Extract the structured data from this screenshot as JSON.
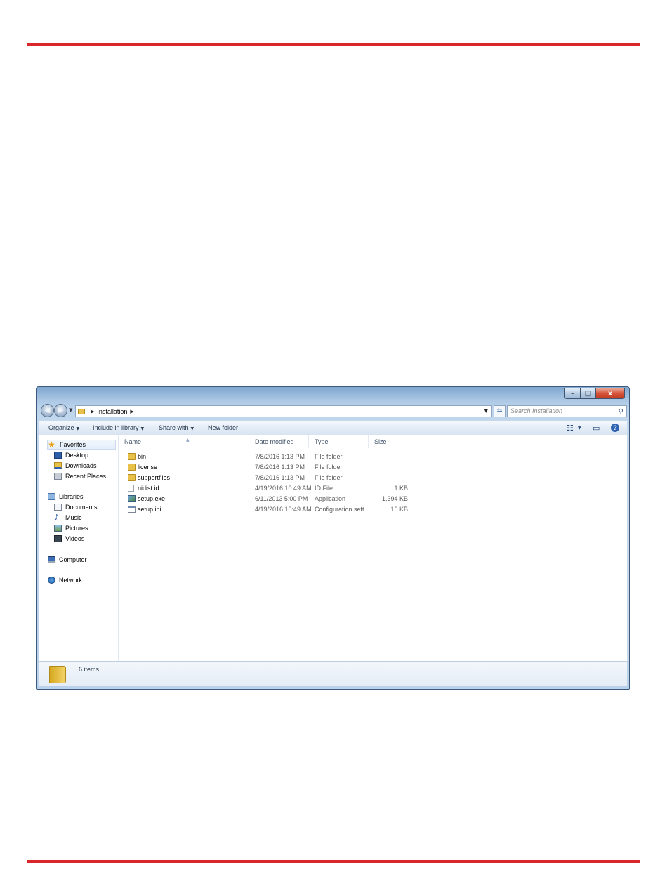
{
  "window": {
    "caption_buttons": {
      "minimize": "–",
      "maximize": "□",
      "close": "x"
    }
  },
  "address_bar": {
    "path": [
      "Installation"
    ],
    "search_placeholder": "Search Installation"
  },
  "toolbar": {
    "organize": "Organize",
    "include_in_library": "Include in library",
    "share_with": "Share with",
    "new_folder": "New folder"
  },
  "navigation": {
    "favorites": {
      "label": "Favorites",
      "items": [
        "Desktop",
        "Downloads",
        "Recent Places"
      ]
    },
    "libraries": {
      "label": "Libraries",
      "items": [
        "Documents",
        "Music",
        "Pictures",
        "Videos"
      ]
    },
    "computer": "Computer",
    "network": "Network"
  },
  "columns": {
    "name": "Name",
    "date_modified": "Date modified",
    "type": "Type",
    "size": "Size"
  },
  "files": [
    {
      "name": "bin",
      "date": "7/8/2016 1:13 PM",
      "type": "File folder",
      "size": "",
      "icon": "folder"
    },
    {
      "name": "license",
      "date": "7/8/2016 1:13 PM",
      "type": "File folder",
      "size": "",
      "icon": "folder"
    },
    {
      "name": "supportfiles",
      "date": "7/8/2016 1:13 PM",
      "type": "File folder",
      "size": "",
      "icon": "folder"
    },
    {
      "name": "nidist.id",
      "date": "4/19/2016 10:49 AM",
      "type": "ID File",
      "size": "1 KB",
      "icon": "file"
    },
    {
      "name": "setup.exe",
      "date": "6/11/2013 5:00 PM",
      "type": "Application",
      "size": "1,394 KB",
      "icon": "app"
    },
    {
      "name": "setup.ini",
      "date": "4/19/2016 10:49 AM",
      "type": "Configuration sett...",
      "size": "16 KB",
      "icon": "ini"
    }
  ],
  "status_bar": {
    "item_count": "6 items"
  },
  "colors": {
    "rule": "#d9262b",
    "folder": "#e8c04a"
  }
}
